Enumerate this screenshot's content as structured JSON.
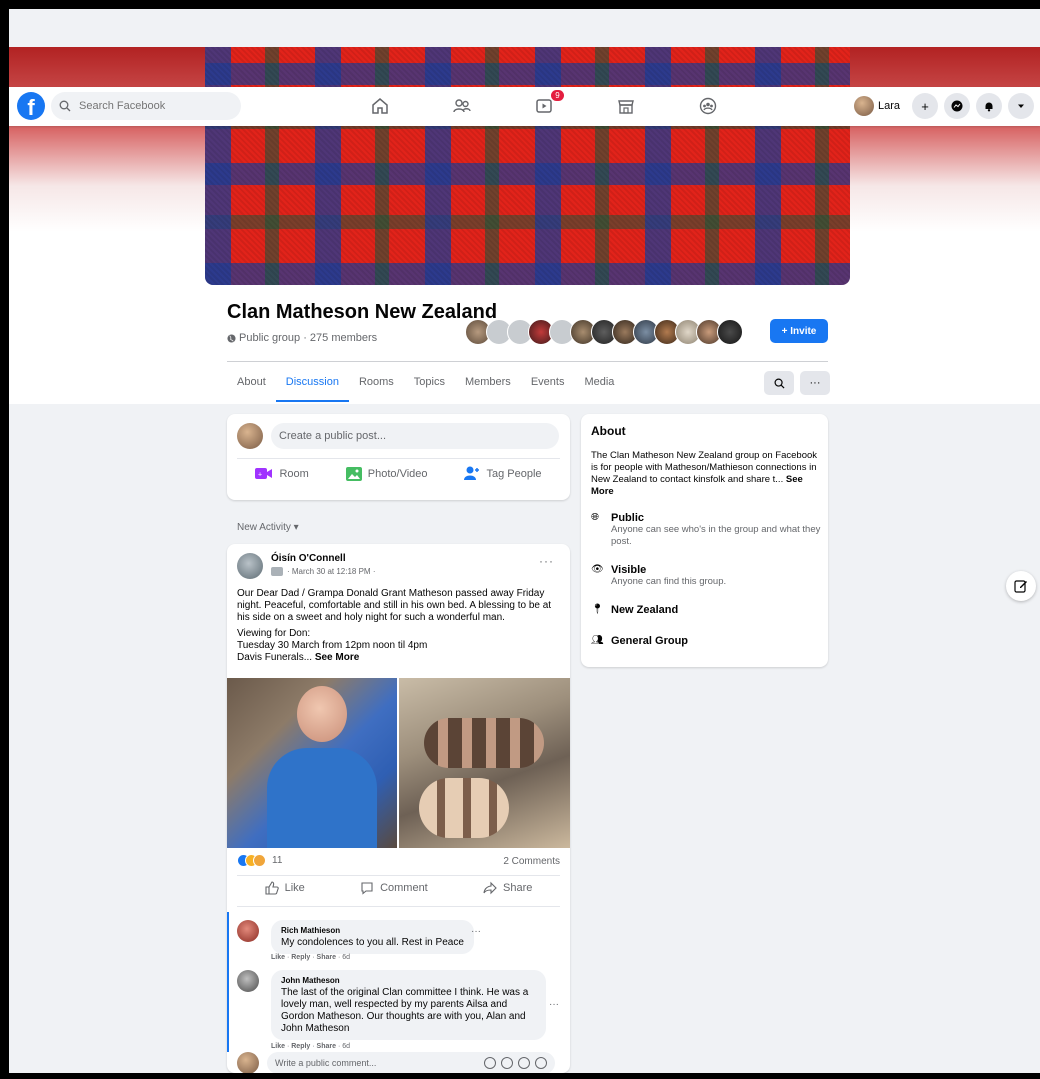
{
  "navbar": {
    "logo": "f",
    "search_placeholder": "Search Facebook",
    "watch_badge": "9",
    "profile_name": "Lara",
    "plus": "+"
  },
  "group": {
    "title": "Clan Matheson New Zealand",
    "meta": "Public group · 275 members",
    "invite_label": "+ Invite",
    "tabs": [
      "About",
      "Discussion",
      "Rooms",
      "Topics",
      "Members",
      "Events",
      "Media"
    ],
    "active_tab": "Discussion",
    "more_label": "···"
  },
  "composer": {
    "placeholder": "Create a public post...",
    "actions": [
      "Room",
      "Photo/Video",
      "Tag People"
    ]
  },
  "feed": {
    "sort_label": "New Activity ▾"
  },
  "post": {
    "author": "Óisín O'Connell",
    "time": "· March 30 at 12:18 PM ·",
    "more": "···",
    "body1": "Our Dear Dad / Grampa Donald Grant Matheson  passed away Friday night. Peaceful, comfortable and still in his own bed. A blessing to be at his side on a sweet and holy night for such a wonderful man.",
    "body2": "Viewing for Don:",
    "body3": "Tuesday 30 March from 12pm noon til 4pm",
    "body4": "Davis Funerals...",
    "see_more": "See More",
    "reaction_count": "11",
    "comments_count": "2 Comments",
    "like": "Like",
    "comment": "Comment",
    "share": "Share"
  },
  "comments": [
    {
      "name": "Rich Mathieson",
      "text": "My condolences to you all. Rest in Peace",
      "like": "Like",
      "reply": "Reply",
      "share": "Share",
      "age": "6d"
    },
    {
      "name": "John Matheson",
      "text": "The last of the original Clan committee I think. He was a lovely man, well respected by my parents Ailsa and Gordon Matheson. Our thoughts are with you, Alan and John Matheson",
      "like": "Like",
      "reply": "Reply",
      "share": "Share",
      "age": "6d"
    }
  ],
  "write_comment": {
    "placeholder": "Write a public comment..."
  },
  "about": {
    "heading": "About",
    "desc": "The Clan Matheson New Zealand group on Facebook is for people with Matheson/Mathieson connections in New Zealand to contact kinsfolk and share t...",
    "see_more": "See More",
    "privacy_title": "Public",
    "privacy_sub": "Anyone can see who's in the group and what they post.",
    "visible_title": "Visible",
    "visible_sub": "Anyone can find this group.",
    "location": "New Zealand",
    "type": "General Group"
  },
  "colors": {
    "brand": "#1877f2",
    "cover_red": "#e2231a",
    "badge_red": "#e41e3f"
  }
}
